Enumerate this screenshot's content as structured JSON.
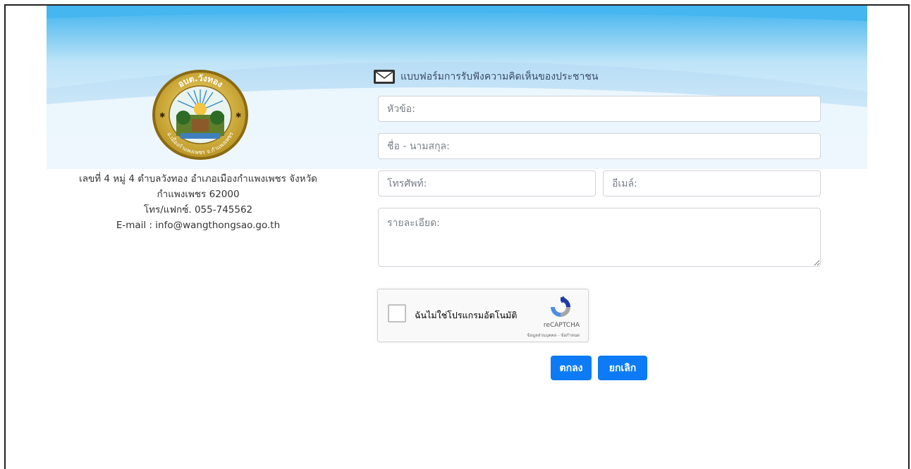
{
  "address": {
    "line1": "เลขที่ 4 หมู่ 4 ตำบลวังทอง อำเภอเมืองกำแพงเพชร จังหวัด",
    "line2": "กำแพงเพชร 62000",
    "line3": "โทร/แฟกซ์. 055-745562",
    "line4": "E-mail : info@wangthongsao.go.th"
  },
  "logo": {
    "top_text": "อบต.วังทอง",
    "bottom_text": "อ.เมืองกำแพงเพชร จ.กำแพงเพชร"
  },
  "form": {
    "title": "แบบฟอร์มการรับฟังความคิดเห็นของประชาชน",
    "subject_placeholder": "หัวข้อ:",
    "name_placeholder": "ชื่อ - นามสกุล:",
    "phone_placeholder": "โทรศัพท์:",
    "email_placeholder": "อีเมล์:",
    "details_placeholder": "รายละเอียด:"
  },
  "captcha": {
    "label": "ฉันไม่ใช่โปรแกรมอัตโนมัติ",
    "brand": "reCAPTCHA",
    "links": "ข้อมูลส่วนบุคคล - ข้อกำหนด"
  },
  "buttons": {
    "submit": "ตกลง",
    "cancel": "ยกเลิก"
  },
  "colors": {
    "accent": "#0d7bf5",
    "sky_top": "#3db2ee",
    "sky_bottom": "#eaf6fd"
  }
}
